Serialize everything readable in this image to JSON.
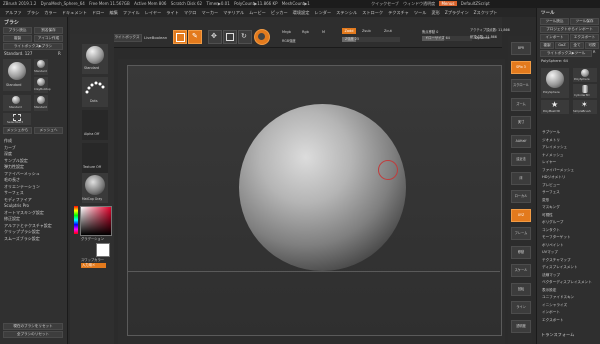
{
  "titlebar": {
    "app": "ZBrush 2019.1.2",
    "doc": "DynaMesh_Sphere_64",
    "free_mem": "Free Mem 11.567GB",
    "active_mem": "Active Mem 806",
    "scratch": "Scratch Disk 62",
    "timer": "Timer▶0.01",
    "polycount": "PolyCount▶11.866 KP",
    "meshcount": "MeshCount▶1",
    "quicksave": "クイックセーブ",
    "transparency": "ウィンドウ透明度",
    "menus": "Menus",
    "script": "DefaultZScript"
  },
  "menubar": [
    "アルファ",
    "ブラシ",
    "カラー",
    "ドキュメント",
    "ドロー",
    "編集",
    "ファイル",
    "レイヤー",
    "ライト",
    "マクロ",
    "マーカー",
    "マテリアル",
    "ムービー",
    "ピッカー",
    "環境設定",
    "レンダー",
    "ステンシル",
    "ストローク",
    "テクスチャ",
    "ツール",
    "変形",
    "Zプラグイン",
    "Zスクリプト"
  ],
  "left_panel": {
    "title": "ブラシ",
    "btn_load": "ブラシ読込",
    "btn_save": "別名保存",
    "btn_clone": "複製",
    "btn_icon": "アイコン作成",
    "btn_lightbox": "ライトボックス▶ブラシ",
    "current_brush": "Standard. 127",
    "r_label": "R",
    "brushes": [
      "Standard",
      "Standard",
      "ClayBuildup",
      "Standard",
      "Standard"
    ],
    "select_label": "SelectRect",
    "btn_mesh": "メッシュから",
    "btn_mesh2": "メッシュへ",
    "menu_items": [
      "作成",
      "カーブ",
      "深度",
      "サンプル設定",
      "弾力性設定",
      "ファイバーメッシュ",
      "毛の長さ",
      "オリエンテーション",
      "サーフェス",
      "モディファイア",
      "Sculptris Pro",
      "オートマスキング設定",
      "修正設定",
      "アルファとテクスチャ設定",
      "クリッププラシ設定",
      "スムーズブラシ設定"
    ],
    "btn_reset": "現在のブラシをリセット",
    "btn_reset_all": "全ブラシのリセット"
  },
  "shelf": {
    "home": "ホームページ",
    "brush": "Standard",
    "dots": "Dots",
    "alpha": "Alpha Off",
    "texture": "Texture Off",
    "material": "MatCap Gray",
    "gradient": "グラデーション",
    "swatch": "スワップカラー",
    "fill": "入力用メ"
  },
  "toolbar": {
    "lightbox": "ライトボックス",
    "liveboolean": "LiveBoolean",
    "edit": "Edit",
    "draw": "Draw",
    "move": "Move",
    "scale": "Scale",
    "rotate": "Rotate",
    "mrgb": "Mrgb",
    "rgb": "Rgb",
    "m": "M",
    "zadd": "Zadd",
    "zsub": "Zsub",
    "zcut": "Zcut",
    "rgb_intensity": "RGB強度",
    "z_intensity": "Z強度 25",
    "focal_shift": "焦点移動 0",
    "draw_size": "ドローサイズ 64",
    "dynamic": "Dynamic",
    "active_points": "アクティブ頂点数: 11,866",
    "total_points": "総頂点数: 11,866"
  },
  "right_strip": [
    "BPR",
    "SPix 3",
    "スクロール",
    "ズーム",
    "実寸",
    "AAHalf",
    "遠近法",
    "床",
    "ローカル",
    "XYZ",
    "フレーム",
    "移動",
    "スケール",
    "回転",
    "ライン",
    "透明度"
  ],
  "right_panel": {
    "title": "ツール",
    "load": "ツール読込",
    "save": "ツール保存",
    "copy": "プロジェクトからインポート",
    "import": "インポート",
    "export": "エクスポート",
    "clone": "複製",
    "goz": "GoZ",
    "all": "全て",
    "visible": "可視",
    "r": "R",
    "lightbox": "ライトボックス▶ツール",
    "current": "PolySphere: 64",
    "tools": [
      "PolySphere",
      "PolySphere",
      "Cylinder3D",
      "PolyMesh3D",
      "SimpleBrush"
    ],
    "sections": [
      "サブツール",
      "ジオメトリ",
      "アレイメッシュ",
      "ナノメッシュ",
      "レイヤー",
      "ファイバーメッシュ",
      "HDジオメトリ",
      "プレビュー",
      "サーフェス",
      "変形",
      "マスキング",
      "可視性",
      "ポリグループ",
      "コンタクト",
      "モーフターゲット",
      "ポリペイント",
      "UVマップ",
      "テクスチャマップ",
      "ディスプレイスメント",
      "法線マップ",
      "ベクターディスプレイスメント",
      "表示設定",
      "ユニファイドスキン",
      "イニシャライズ",
      "インポート",
      "エクスポート"
    ],
    "transform": "トランスフォーム"
  },
  "accent": "#e37a1d"
}
